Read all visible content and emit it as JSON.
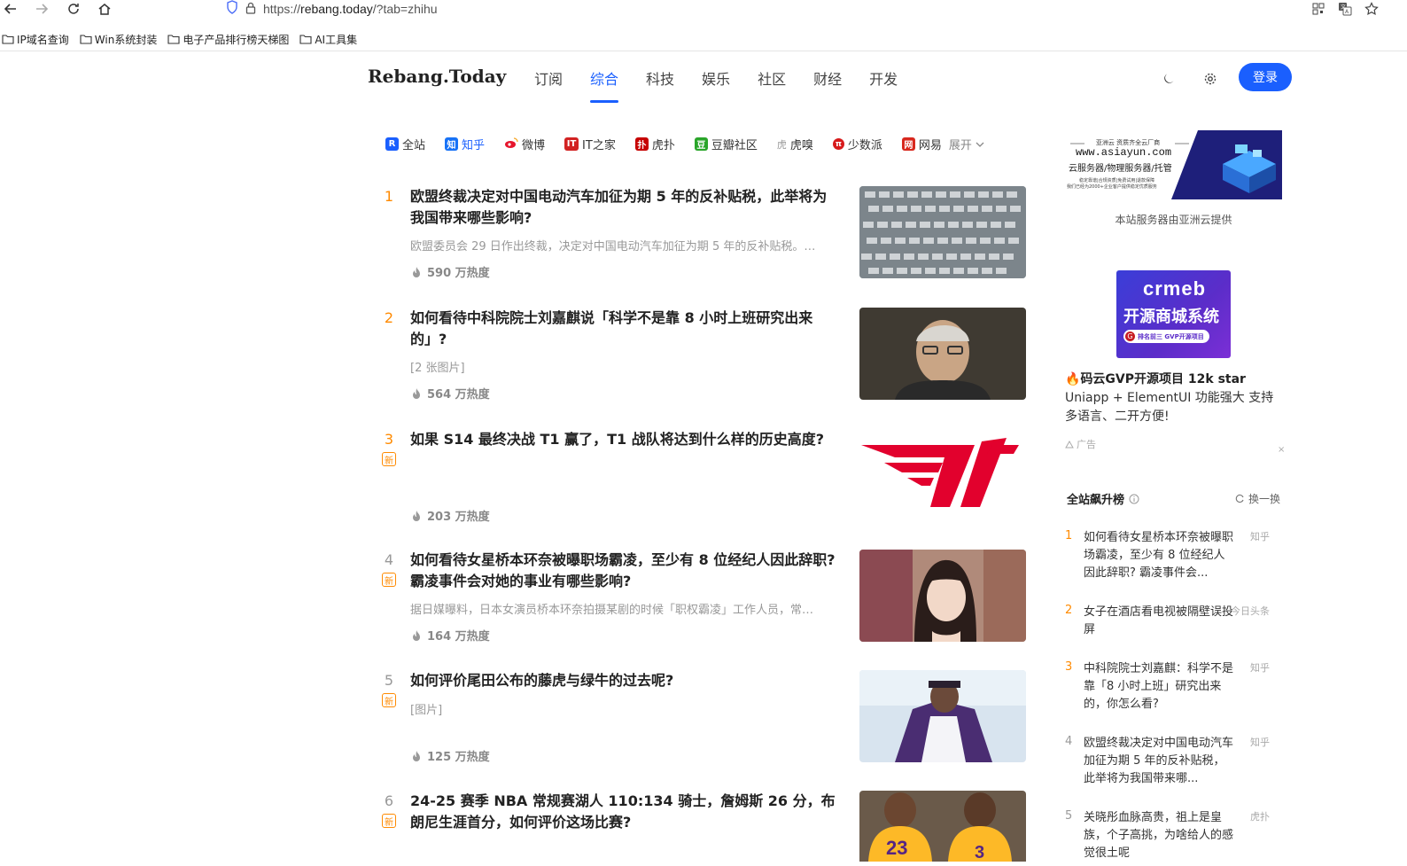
{
  "browser": {
    "url_protocol": "https://",
    "url_host": "rebang.today",
    "url_path": "/?tab=zhihu",
    "bookmarks": [
      "IP域名查询",
      "Win系统封装",
      "电子产品排行榜天梯图",
      "AI工具集"
    ]
  },
  "site": {
    "logo": "Rebang.Today",
    "nav": [
      "订阅",
      "综合",
      "科技",
      "娱乐",
      "社区",
      "财经",
      "开发"
    ],
    "login": "登录"
  },
  "sources": {
    "tabs": [
      {
        "label": "全站",
        "icon": "R",
        "color": "#1a5ffe"
      },
      {
        "label": "知乎",
        "icon": "知",
        "color": "#1772f6"
      },
      {
        "label": "微博",
        "icon": "weibo-icon",
        "color": "#e6162d"
      },
      {
        "label": "IT之家",
        "icon": "IT",
        "color": "#d22222"
      },
      {
        "label": "虎扑",
        "icon": "扑",
        "color": "#c60100"
      },
      {
        "label": "豆瓣社区",
        "icon": "豆",
        "color": "#2aa52a"
      },
      {
        "label": "虎嗅",
        "icon": "虎",
        "color": "#999999"
      },
      {
        "label": "少数派",
        "icon": "π",
        "color": "#d71a1b"
      },
      {
        "label": "网易",
        "icon": "网",
        "color": "#d8281e"
      }
    ],
    "expand": "展开"
  },
  "feed": [
    {
      "rank": "1",
      "title": "欧盟终裁决定对中国电动汽车加征为期 5 年的反补贴税，此举将为我国带来哪些影响?",
      "desc": "欧盟委员会 29 日作出终裁，决定对中国电动汽车加征为期 5 年的反补贴税。…",
      "heat": "590 万热度",
      "is_new": false,
      "new_label": ""
    },
    {
      "rank": "2",
      "title": "如何看待中科院院士刘嘉麒说「科学不是靠 8 小时上班研究出来的」?",
      "desc": "[2 张图片]",
      "heat": "564 万热度",
      "is_new": false,
      "new_label": ""
    },
    {
      "rank": "3",
      "title": "如果 S14 最终决战 T1 赢了，T1 战队将达到什么样的历史高度?",
      "desc": "",
      "heat": "203 万热度",
      "is_new": true,
      "new_label": "新"
    },
    {
      "rank": "4",
      "title": "如何看待女星桥本环奈被曝职场霸凌，至少有 8 位经纪人因此辞职?霸凌事件会对她的事业有哪些影响?",
      "desc": "据日媒曝料，日本女演员桥本环奈拍摄某剧的时候「职权霸凌」工作人员，常…",
      "heat": "164 万热度",
      "is_new": true,
      "new_label": "新"
    },
    {
      "rank": "5",
      "title": "如何评价尾田公布的藤虎与绿牛的过去呢?",
      "desc": "[图片]",
      "heat": "125 万热度",
      "is_new": true,
      "new_label": "新"
    },
    {
      "rank": "6",
      "title": "24-25 赛季 NBA 常规赛湖人 110:134 骑士，詹姆斯 26 分，布朗尼生涯首分，如何评价这场比赛?",
      "desc": "",
      "heat": "",
      "is_new": true,
      "new_label": "新"
    }
  ],
  "thumbs": {
    "t1_logo": "T1",
    "lakers_num_1": "23",
    "lakers_num_2": "3"
  },
  "sidebar": {
    "ad1": {
      "tagline": "亚洲云 资质齐全云厂商",
      "domain": "www.asiayun.com",
      "services": "云服务器/物理服务器/托管",
      "small1": "稳定靠谱|合规资质|免费试用|退款保障",
      "small2": "我们已经为2000+企业客户提供稳定优质服务",
      "caption": "本站服务器由亚洲云提供"
    },
    "ad2": {
      "brand": "crmeb",
      "headline": "开源商城系统",
      "pill": "排名前三 GVP开源项目",
      "text_bold": "码云GVP开源项目 12k star",
      "text_rest": " Uniapp + ElementUI 功能强大 支持多语言、二开方便!",
      "tag": "广告",
      "close": "×"
    },
    "rise": {
      "title": "全站飙升榜",
      "refresh": "换一换",
      "items": [
        {
          "num": "1",
          "title": "如何看待女星桥本环奈被曝职场霸凌，至少有 8 位经纪人因此辞职? 霸凌事件会...",
          "src": "知乎"
        },
        {
          "num": "2",
          "title": "女子在酒店看电视被隔壁误投屏",
          "src": "今日头条"
        },
        {
          "num": "3",
          "title": "中科院院士刘嘉麒：科学不是靠「8 小时上班」研究出来的，你怎么看?",
          "src": "知乎"
        },
        {
          "num": "4",
          "title": "欧盟终裁决定对中国电动汽车加征为期 5 年的反补贴税，此举将为我国带来哪...",
          "src": "知乎"
        },
        {
          "num": "5",
          "title": "关晓彤血脉高贵，祖上是皇族，个子高挑，为啥给人的感觉很土呢",
          "src": "虎扑"
        }
      ]
    }
  }
}
